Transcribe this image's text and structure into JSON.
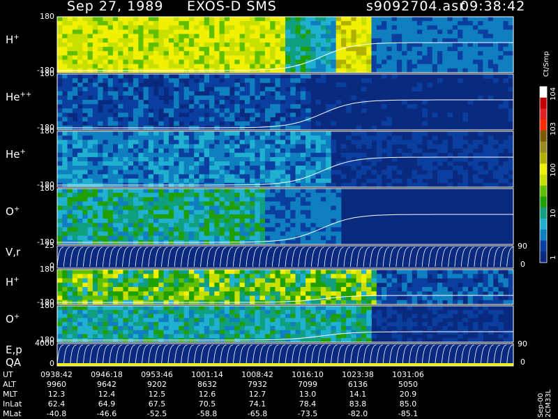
{
  "header": {
    "date": "Sep 27, 1989",
    "instrument": "EXOS-D SMS",
    "file": "s9092704.asr",
    "time": "09:38:42"
  },
  "colorbar": {
    "units": "Ct/Smp",
    "labels": [
      "10^4",
      "10^3",
      "100",
      "10",
      "1"
    ],
    "colors": [
      "#ffffff",
      "#c00000",
      "#e02020",
      "#ff2a00",
      "#7a5a00",
      "#9a8a20",
      "#b0b000",
      "#f0f000",
      "#c8e000",
      "#60c000",
      "#20a000",
      "#10a080",
      "#20b0d0",
      "#107fc0",
      "#0a3fa0",
      "#0a2a80"
    ]
  },
  "panels": [
    {
      "label": "H",
      "charge": "+",
      "top_tick": "180",
      "bottom_tick": "-180",
      "key": "h"
    },
    {
      "label": "He",
      "charge": "++",
      "top_tick": "180",
      "bottom_tick": "-180",
      "key": "he2"
    },
    {
      "label": "He",
      "charge": "+",
      "top_tick": "180",
      "bottom_tick": "-180",
      "key": "he1"
    },
    {
      "label": "O",
      "charge": "+",
      "top_tick": "180",
      "bottom_tick": "-180",
      "key": "o"
    },
    {
      "label": "V,r",
      "charge": "",
      "top_tick": "25",
      "bottom_tick": "0",
      "right_top": "90",
      "right_bottom": "0",
      "key": "vr"
    },
    {
      "label": "H",
      "charge": "+",
      "top_tick": "180",
      "bottom_tick": "-180",
      "key": "h2"
    },
    {
      "label": "O",
      "charge": "+",
      "top_tick": "180",
      "bottom_tick": "-180",
      "key": "o2"
    },
    {
      "label": "E,p",
      "charge": "",
      "label2": "QA",
      "top_tick": "4000",
      "bottom_tick": "0",
      "right_top": "90",
      "right_bottom": "0",
      "key": "ep"
    }
  ],
  "footer": {
    "rows": [
      {
        "name": "UT",
        "values": [
          "0938:42",
          "0946:18",
          "0953:46",
          "1001:14",
          "1008:42",
          "1016:10",
          "1023:38",
          "1031:06"
        ]
      },
      {
        "name": "ALT",
        "values": [
          "9960",
          "9642",
          "9202",
          "8632",
          "7932",
          "7099",
          "6136",
          "5050"
        ]
      },
      {
        "name": "MLT",
        "values": [
          "12.3",
          "12.4",
          "12.5",
          "12.6",
          "12.7",
          "13.0",
          "14.1",
          "20.9"
        ]
      },
      {
        "name": "InLat",
        "values": [
          "62.4",
          "64.9",
          "67.5",
          "70.5",
          "74.1",
          "78.4",
          "83.8",
          "85.0"
        ]
      },
      {
        "name": "MLat",
        "values": [
          "-40.8",
          "-46.6",
          "-52.5",
          "-58.8",
          "-65.8",
          "-73.5",
          "-82.0",
          "-85.1"
        ]
      }
    ],
    "side_label": "Sep-00 2CM33L"
  },
  "chart_data": {
    "type": "heatmap",
    "title": "Sep 27, 1989 EXOS-D SMS",
    "x_ticks": [
      "0938:42",
      "0946:18",
      "0953:46",
      "1001:14",
      "1008:42",
      "1016:10",
      "1023:38",
      "1031:06"
    ],
    "colorbar_units": "Ct/Smp",
    "colorbar_ticks": [
      "1",
      "10",
      "100",
      "10^3",
      "10^4"
    ],
    "series": [
      {
        "name": "H+",
        "ylim": [
          -180,
          180
        ]
      },
      {
        "name": "He++",
        "ylim": [
          -180,
          180
        ]
      },
      {
        "name": "He+",
        "ylim": [
          -180,
          180
        ]
      },
      {
        "name": "O+",
        "ylim": [
          -180,
          180
        ]
      },
      {
        "name": "V,r",
        "ylim": [
          0,
          25
        ]
      },
      {
        "name": "H+",
        "ylim": [
          -180,
          180
        ]
      },
      {
        "name": "O+",
        "ylim": [
          -180,
          180
        ]
      },
      {
        "name": "E,p",
        "ylim": [
          0,
          4000
        ]
      }
    ]
  }
}
